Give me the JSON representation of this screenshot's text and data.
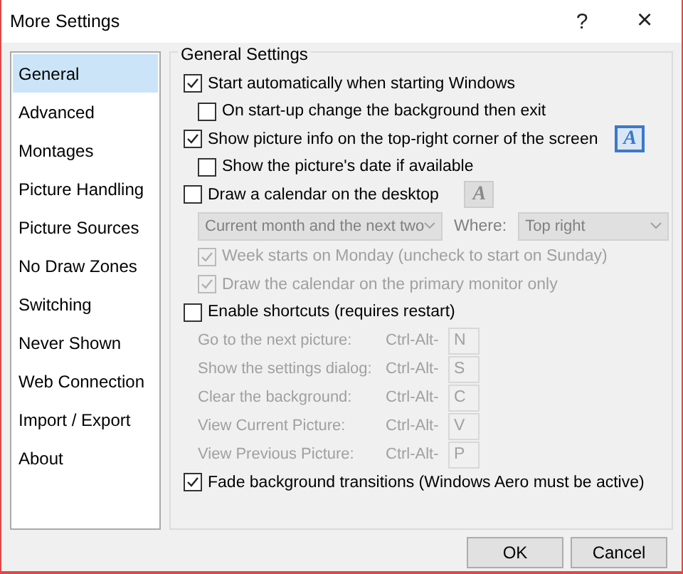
{
  "window": {
    "title": "More Settings",
    "help": "?",
    "close": "×"
  },
  "sidebar": {
    "items": [
      {
        "label": "General",
        "selected": true
      },
      {
        "label": "Advanced",
        "selected": false
      },
      {
        "label": "Montages",
        "selected": false
      },
      {
        "label": "Picture Handling",
        "selected": false
      },
      {
        "label": "Picture Sources",
        "selected": false
      },
      {
        "label": "No Draw Zones",
        "selected": false
      },
      {
        "label": "Switching",
        "selected": false
      },
      {
        "label": "Never Shown",
        "selected": false
      },
      {
        "label": "Web Connection",
        "selected": false
      },
      {
        "label": "Import / Export",
        "selected": false
      },
      {
        "label": "About",
        "selected": false
      }
    ]
  },
  "group": {
    "title": "General Settings",
    "items": [
      {
        "kind": "checkbox",
        "label": "Start automatically when starting Windows",
        "checked": true,
        "disabled": false,
        "children": [
          {
            "kind": "checkbox",
            "label": "On start-up change the background then exit",
            "checked": false,
            "disabled": false
          }
        ]
      },
      {
        "kind": "checkbox",
        "label": "Show picture info on the top-right corner of the screen",
        "checked": true,
        "disabled": false,
        "font_button": {
          "glyph": "A",
          "disabled": false
        },
        "children": [
          {
            "kind": "checkbox",
            "label": "Show the picture's date if available",
            "checked": false,
            "disabled": false
          }
        ]
      },
      {
        "kind": "checkbox",
        "label": "Draw a calendar on the desktop",
        "checked": false,
        "disabled": false,
        "font_button": {
          "glyph": "A",
          "disabled": true
        },
        "children": [
          {
            "kind": "selects",
            "disabled": true,
            "value": "Current month and the next two",
            "where_label": "Where:",
            "where_value": "Top right"
          },
          {
            "kind": "checkbox",
            "label": "Week starts on Monday (uncheck to start on Sunday)",
            "checked": true,
            "disabled": true
          },
          {
            "kind": "checkbox",
            "label": "Draw the calendar on the primary monitor only",
            "checked": true,
            "disabled": true
          }
        ]
      },
      {
        "kind": "checkbox",
        "label": "Enable shortcuts (requires restart)",
        "checked": false,
        "disabled": false,
        "children": [
          {
            "kind": "shortcut",
            "label": "Go to the next picture:",
            "modifier": "Ctrl-Alt-",
            "key": "N",
            "disabled": true
          },
          {
            "kind": "shortcut",
            "label": "Show the settings dialog:",
            "modifier": "Ctrl-Alt-",
            "key": "S",
            "disabled": true
          },
          {
            "kind": "shortcut",
            "label": "Clear the background:",
            "modifier": "Ctrl-Alt-",
            "key": "C",
            "disabled": true
          },
          {
            "kind": "shortcut",
            "label": "View Current Picture:",
            "modifier": "Ctrl-Alt-",
            "key": "V",
            "disabled": true
          },
          {
            "kind": "shortcut",
            "label": "View Previous Picture:",
            "modifier": "Ctrl-Alt-",
            "key": "P",
            "disabled": true
          }
        ]
      },
      {
        "kind": "checkbox",
        "label": "Fade background transitions (Windows Aero must be active)",
        "checked": true,
        "disabled": false
      }
    ]
  },
  "buttons": [
    {
      "label": "OK"
    },
    {
      "label": "Cancel"
    }
  ]
}
